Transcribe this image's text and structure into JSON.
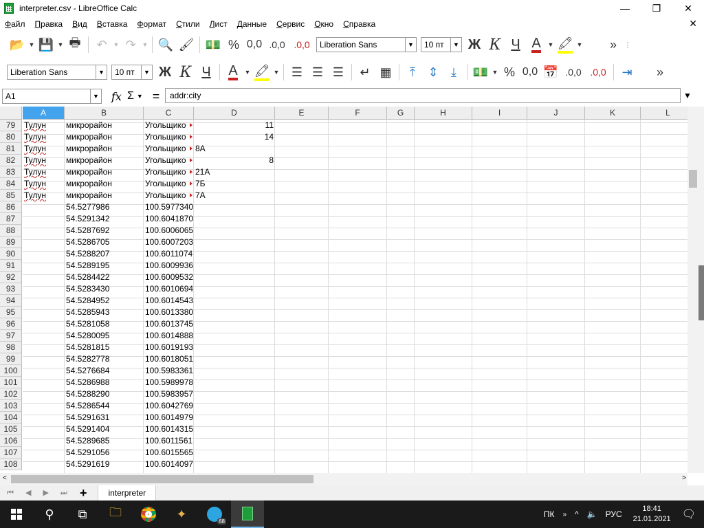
{
  "window": {
    "title": "interpreter.csv - LibreOffice Calc",
    "minimize": "—",
    "maximize": "❐",
    "close": "✕"
  },
  "menu": [
    "Файл",
    "Правка",
    "Вид",
    "Вставка",
    "Формат",
    "Стили",
    "Лист",
    "Данные",
    "Сервис",
    "Окно",
    "Справка"
  ],
  "toolbar1": {
    "font_name": "Liberation Sans",
    "font_size": "10 пт",
    "bold": "Ж",
    "italic": "К",
    "underline": "Ч",
    "font_color": "A",
    "percent": "%",
    "number": "0,0",
    "add_decimal": ".0,0",
    "del_decimal": ".0,0"
  },
  "toolbar2": {
    "font_name": "Liberation Sans",
    "font_size": "10 пт",
    "bold": "Ж",
    "italic": "К",
    "underline": "Ч",
    "font_color": "A",
    "percent": "%",
    "number": "0,0",
    "add_decimal": ".0,0",
    "del_decimal": ".0,0"
  },
  "formula_bar": {
    "cell_ref": "A1",
    "fx": "fx",
    "sigma": "Σ",
    "equals": "=",
    "content": "addr:city"
  },
  "columns": [
    "A",
    "B",
    "C",
    "D",
    "E",
    "F",
    "G",
    "H",
    "I",
    "J",
    "K",
    "L"
  ],
  "selected_column": "A",
  "rows": [
    {
      "n": "79",
      "a": "Тулун",
      "b": "микрорайон",
      "c": "Угольщико",
      "d": "11",
      "d_num": true,
      "c_trunc": true
    },
    {
      "n": "80",
      "a": "Тулун",
      "b": "микрорайон",
      "c": "Угольщико",
      "d": "14",
      "d_num": true,
      "c_trunc": true
    },
    {
      "n": "81",
      "a": "Тулун",
      "b": "микрорайон",
      "c": "Угольщико",
      "d": "8А",
      "d_num": false,
      "c_trunc": true
    },
    {
      "n": "82",
      "a": "Тулун",
      "b": "микрорайон",
      "c": "Угольщико",
      "d": "8",
      "d_num": true,
      "c_trunc": true
    },
    {
      "n": "83",
      "a": "Тулун",
      "b": "микрорайон",
      "c": "Угольщико",
      "d": "21А",
      "d_num": false,
      "c_trunc": true
    },
    {
      "n": "84",
      "a": "Тулун",
      "b": "микрорайон",
      "c": "Угольщико",
      "d": "7Б",
      "d_num": false,
      "c_trunc": true
    },
    {
      "n": "85",
      "a": "Тулун",
      "b": "микрорайон",
      "c": "Угольщико",
      "d": "7А",
      "d_num": false,
      "c_trunc": true
    },
    {
      "n": "86",
      "a": "",
      "b": "54.5277986",
      "c": "100.5977340",
      "d": ""
    },
    {
      "n": "87",
      "a": "",
      "b": "54.5291342",
      "c": "100.6041870",
      "d": ""
    },
    {
      "n": "88",
      "a": "",
      "b": "54.5287692",
      "c": "100.6006065",
      "d": ""
    },
    {
      "n": "89",
      "a": "",
      "b": "54.5286705",
      "c": "100.6007203",
      "d": ""
    },
    {
      "n": "90",
      "a": "",
      "b": "54.5288207",
      "c": "100.6011074",
      "d": ""
    },
    {
      "n": "91",
      "a": "",
      "b": "54.5289195",
      "c": "100.6009936",
      "d": ""
    },
    {
      "n": "92",
      "a": "",
      "b": "54.5284422",
      "c": "100.6009532",
      "d": ""
    },
    {
      "n": "93",
      "a": "",
      "b": "54.5283430",
      "c": "100.6010694",
      "d": ""
    },
    {
      "n": "94",
      "a": "",
      "b": "54.5284952",
      "c": "100.6014543",
      "d": ""
    },
    {
      "n": "95",
      "a": "",
      "b": "54.5285943",
      "c": "100.6013380",
      "d": ""
    },
    {
      "n": "96",
      "a": "",
      "b": "54.5281058",
      "c": "100.6013745",
      "d": ""
    },
    {
      "n": "97",
      "a": "",
      "b": "54.5280095",
      "c": "100.6014888",
      "d": ""
    },
    {
      "n": "98",
      "a": "",
      "b": "54.5281815",
      "c": "100.6019193",
      "d": ""
    },
    {
      "n": "99",
      "a": "",
      "b": "54.5282778",
      "c": "100.6018051",
      "d": ""
    },
    {
      "n": "100",
      "a": "",
      "b": "54.5276684",
      "c": "100.5983361",
      "d": ""
    },
    {
      "n": "101",
      "a": "",
      "b": "54.5286988",
      "c": "100.5989978",
      "d": ""
    },
    {
      "n": "102",
      "a": "",
      "b": "54.5288290",
      "c": "100.5983957",
      "d": ""
    },
    {
      "n": "103",
      "a": "",
      "b": "54.5286544",
      "c": "100.6042769",
      "d": ""
    },
    {
      "n": "104",
      "a": "",
      "b": "54.5291631",
      "c": "100.6014979",
      "d": ""
    },
    {
      "n": "105",
      "a": "",
      "b": "54.5291404",
      "c": "100.6014315",
      "d": ""
    },
    {
      "n": "106",
      "a": "",
      "b": "54.5289685",
      "c": "100.6011561",
      "d": ""
    },
    {
      "n": "107",
      "a": "",
      "b": "54.5291056",
      "c": "100.6015565",
      "d": ""
    },
    {
      "n": "108",
      "a": "",
      "b": "54.5291619",
      "c": "100.6014097",
      "d": ""
    }
  ],
  "sheet_tabs": [
    "interpreter"
  ],
  "taskbar": {
    "lang_short": "ПК",
    "lang": "РУС",
    "time": "18:41",
    "date": "21.01.2021",
    "telegram_badge": "68"
  },
  "colors": {
    "selected_header": "#43a3ec",
    "font_color": "#c9211e",
    "highlight": "#ffff00"
  }
}
